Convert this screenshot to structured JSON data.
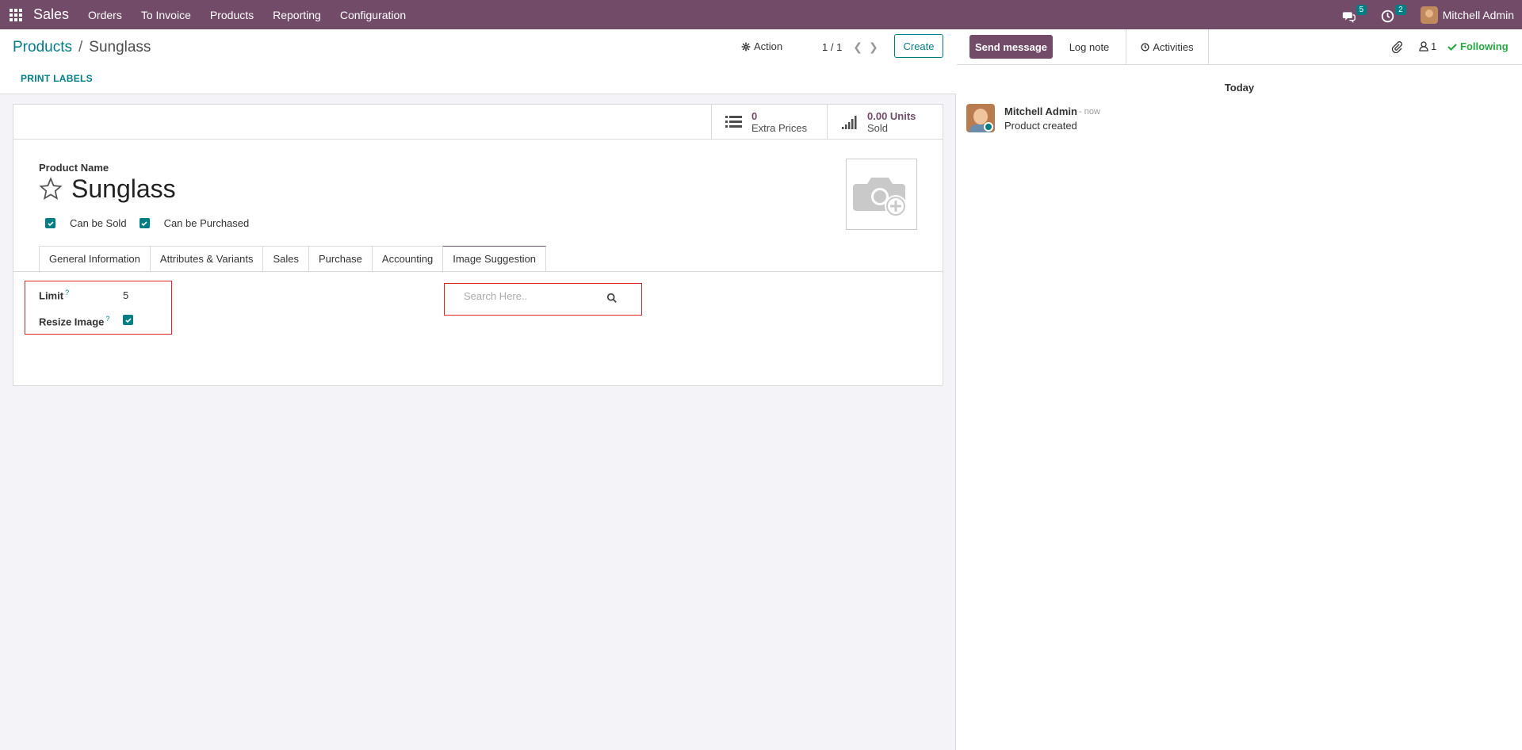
{
  "navbar": {
    "brand": "Sales",
    "menu": [
      "Orders",
      "To Invoice",
      "Products",
      "Reporting",
      "Configuration"
    ],
    "messages_count": "5",
    "activities_count": "2",
    "user_name": "Mitchell Admin"
  },
  "control_panel": {
    "breadcrumb_parent": "Products",
    "breadcrumb_sep": "/",
    "breadcrumb_current": "Sunglass",
    "action_label": "Action",
    "pager": "1 / 1",
    "create_label": "Create",
    "print_labels": "PRINT LABELS"
  },
  "stat_buttons": {
    "extra_prices_value": "0",
    "extra_prices_label": "Extra Prices",
    "units_sold_value": "0.00 Units",
    "units_sold_label": "Sold"
  },
  "form": {
    "product_name_label": "Product Name",
    "product_name": "Sunglass",
    "can_be_sold": "Can be Sold",
    "can_be_purchased": "Can be Purchased",
    "tabs": [
      "General Information",
      "Attributes & Variants",
      "Sales",
      "Purchase",
      "Accounting",
      "Image Suggestion"
    ],
    "active_tab": "Image Suggestion",
    "limit_label": "Limit",
    "limit_value": "5",
    "resize_label": "Resize Image",
    "help_mark": "?",
    "search_placeholder": "Search Here.."
  },
  "chatter": {
    "send_message": "Send message",
    "log_note": "Log note",
    "activities": "Activities",
    "followers_count": "1",
    "following": "Following",
    "date_separator": "Today",
    "message": {
      "author": "Mitchell Admin",
      "time": "- now",
      "body": "Product created"
    }
  },
  "colors": {
    "brand": "#714b67",
    "accent": "#017e84",
    "highlight_box": "#e02424",
    "following": "#28a745"
  }
}
